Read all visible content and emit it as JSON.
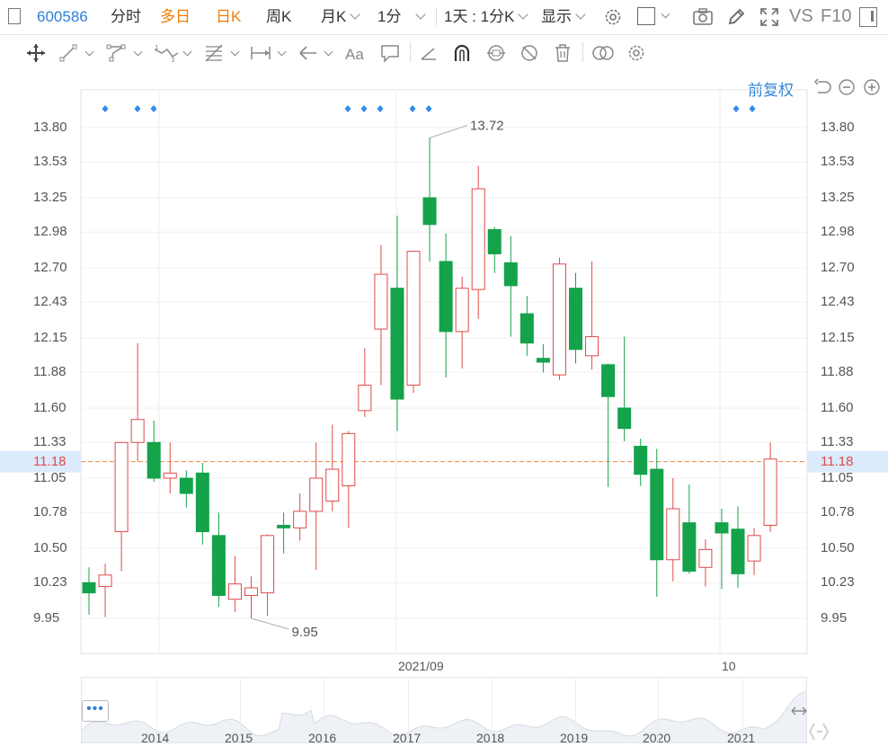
{
  "toolbar": {
    "stock_code": "600586",
    "fenshi": "分时",
    "duori": "多日",
    "rik": "日K",
    "zhouk": "周K",
    "yuek": "月K",
    "minute": "1分",
    "day_minute": "1天 : 1分K",
    "display": "显示",
    "vs": "VS",
    "f10": "F10"
  },
  "adjust_label": "前复权",
  "price_axis": {
    "left_labels": [
      "13.80",
      "13.53",
      "13.25",
      "12.98",
      "12.70",
      "12.43",
      "12.15",
      "11.88",
      "11.60",
      "11.33",
      "11.18",
      "11.05",
      "10.78",
      "10.50",
      "10.23",
      "9.95"
    ],
    "right_labels": [
      "13.80",
      "13.53",
      "13.25",
      "12.98",
      "12.70",
      "12.43",
      "12.15",
      "11.88",
      "11.60",
      "11.33",
      "11.18",
      "11.05",
      "10.78",
      "10.50",
      "10.23",
      "9.95"
    ],
    "current_price": "11.18"
  },
  "annotations": {
    "high": "13.72",
    "low": "9.95"
  },
  "x_axis_labels": [
    "2021/09",
    "10"
  ],
  "overview_years": [
    "2014",
    "2015",
    "2016",
    "2017",
    "2018",
    "2019",
    "2020",
    "2021"
  ],
  "colors": {
    "up": "#e04a4a",
    "down": "#14a24a",
    "accent": "#2d7fd8",
    "current_line": "#f08a3e"
  },
  "chart_data": {
    "type": "candlestick",
    "ylim": [
      9.95,
      13.8
    ],
    "current": 11.18,
    "candles": [
      {
        "o": 10.23,
        "c": 10.15,
        "h": 10.35,
        "l": 9.98
      },
      {
        "o": 10.2,
        "c": 10.29,
        "h": 10.38,
        "l": 9.96
      },
      {
        "o": 10.63,
        "c": 11.33,
        "h": 11.33,
        "l": 10.32
      },
      {
        "o": 11.33,
        "c": 11.51,
        "h": 12.11,
        "l": 11.18
      },
      {
        "o": 11.33,
        "c": 11.05,
        "h": 11.5,
        "l": 11.02
      },
      {
        "o": 11.05,
        "c": 11.09,
        "h": 11.33,
        "l": 10.93
      },
      {
        "o": 11.05,
        "c": 10.93,
        "h": 11.11,
        "l": 10.82
      },
      {
        "o": 11.09,
        "c": 10.63,
        "h": 11.17,
        "l": 10.53
      },
      {
        "o": 10.6,
        "c": 10.13,
        "h": 10.78,
        "l": 10.04
      },
      {
        "o": 10.1,
        "c": 10.22,
        "h": 10.44,
        "l": 10.0
      },
      {
        "o": 10.13,
        "c": 10.19,
        "h": 10.28,
        "l": 9.95
      },
      {
        "o": 10.15,
        "c": 10.6,
        "h": 10.61,
        "l": 9.97
      },
      {
        "o": 10.68,
        "c": 10.66,
        "h": 10.78,
        "l": 10.46
      },
      {
        "o": 10.66,
        "c": 10.79,
        "h": 10.93,
        "l": 10.56
      },
      {
        "o": 10.79,
        "c": 11.05,
        "h": 11.33,
        "l": 10.33
      },
      {
        "o": 10.87,
        "c": 11.12,
        "h": 11.47,
        "l": 10.79
      },
      {
        "o": 10.99,
        "c": 11.4,
        "h": 11.42,
        "l": 10.66
      },
      {
        "o": 11.58,
        "c": 11.78,
        "h": 12.07,
        "l": 11.53
      },
      {
        "o": 12.22,
        "c": 12.65,
        "h": 12.88,
        "l": 11.78
      },
      {
        "o": 12.54,
        "c": 11.67,
        "h": 13.11,
        "l": 11.42
      },
      {
        "o": 11.78,
        "c": 12.83,
        "h": 12.83,
        "l": 11.72
      },
      {
        "o": 13.25,
        "c": 13.04,
        "h": 13.72,
        "l": 12.75
      },
      {
        "o": 12.75,
        "c": 12.2,
        "h": 12.97,
        "l": 11.84
      },
      {
        "o": 12.2,
        "c": 12.54,
        "h": 12.63,
        "l": 11.91
      },
      {
        "o": 12.53,
        "c": 13.32,
        "h": 13.5,
        "l": 12.3
      },
      {
        "o": 13.0,
        "c": 12.81,
        "h": 13.02,
        "l": 12.66
      },
      {
        "o": 12.74,
        "c": 12.56,
        "h": 12.95,
        "l": 12.16
      },
      {
        "o": 12.34,
        "c": 12.11,
        "h": 12.48,
        "l": 12.01
      },
      {
        "o": 11.99,
        "c": 11.96,
        "h": 12.1,
        "l": 11.88
      },
      {
        "o": 11.86,
        "c": 12.73,
        "h": 12.78,
        "l": 11.82
      },
      {
        "o": 12.54,
        "c": 12.06,
        "h": 12.66,
        "l": 11.95
      },
      {
        "o": 12.01,
        "c": 12.16,
        "h": 12.75,
        "l": 11.9
      },
      {
        "o": 11.94,
        "c": 11.69,
        "h": 11.95,
        "l": 10.98
      },
      {
        "o": 11.6,
        "c": 11.44,
        "h": 12.16,
        "l": 11.34
      },
      {
        "o": 11.3,
        "c": 11.08,
        "h": 11.36,
        "l": 10.99
      },
      {
        "o": 11.12,
        "c": 10.41,
        "h": 11.28,
        "l": 10.12
      },
      {
        "o": 10.41,
        "c": 10.81,
        "h": 11.05,
        "l": 10.24
      },
      {
        "o": 10.7,
        "c": 10.32,
        "h": 11.0,
        "l": 10.3
      },
      {
        "o": 10.35,
        "c": 10.49,
        "h": 10.57,
        "l": 10.2
      },
      {
        "o": 10.7,
        "c": 10.62,
        "h": 10.81,
        "l": 10.18
      },
      {
        "o": 10.65,
        "c": 10.3,
        "h": 10.83,
        "l": 10.19
      },
      {
        "o": 10.4,
        "c": 10.6,
        "h": 10.66,
        "l": 10.29
      },
      {
        "o": 10.68,
        "c": 11.2,
        "h": 11.33,
        "l": 10.63
      }
    ]
  }
}
